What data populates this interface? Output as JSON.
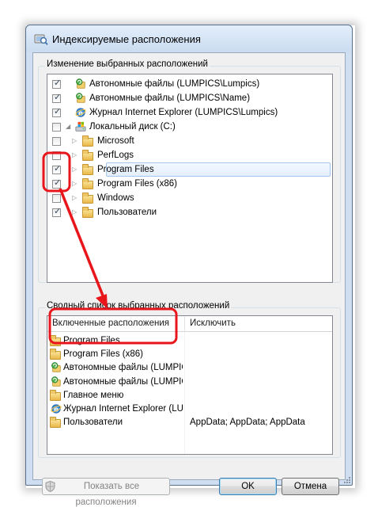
{
  "window": {
    "title": "Индексируемые расположения",
    "title_icon": "indexing-options-icon"
  },
  "change_group": {
    "label": "Изменение выбранных расположений",
    "items": [
      {
        "label": "Автономные файлы (LUMPICS\\Lumpics)",
        "checked": true,
        "icon": "offline-files-icon",
        "level": 0
      },
      {
        "label": "Автономные файлы (LUMPICS\\Name)",
        "checked": true,
        "icon": "offline-files-icon",
        "level": 0
      },
      {
        "label": "Журнал Internet Explorer (LUMPICS\\Lumpics)",
        "checked": true,
        "icon": "internet-explorer-icon",
        "level": 0
      },
      {
        "label": "Локальный диск (C:)",
        "checked": false,
        "icon": "local-disk-icon",
        "level": 0,
        "expanded": true
      },
      {
        "label": "Microsoft",
        "checked": false,
        "icon": "folder-icon",
        "level": 1
      },
      {
        "label": "PerfLogs",
        "checked": false,
        "icon": "folder-icon",
        "level": 1
      },
      {
        "label": "Program Files",
        "checked": true,
        "icon": "folder-icon",
        "level": 1,
        "selected": true
      },
      {
        "label": "Program Files (x86)",
        "checked": true,
        "icon": "folder-icon",
        "level": 1
      },
      {
        "label": "Windows",
        "checked": false,
        "icon": "folder-icon",
        "level": 1
      },
      {
        "label": "Пользователи",
        "checked": true,
        "icon": "folder-icon",
        "level": 1
      }
    ]
  },
  "summary_group": {
    "label": "Сводный список выбранных расположений",
    "columns": [
      "Включенные расположения",
      "Исключить"
    ],
    "rows": [
      {
        "included": "Program Files",
        "exclude": "",
        "icon": "folder-icon"
      },
      {
        "included": "Program Files (x86)",
        "exclude": "",
        "icon": "folder-icon"
      },
      {
        "included": "Автономные файлы (LUMPICS\\Lumpics)",
        "exclude": "",
        "icon": "offline-files-icon"
      },
      {
        "included": "Автономные файлы (LUMPICS\\Name)",
        "exclude": "",
        "icon": "offline-files-icon"
      },
      {
        "included": "Главное меню",
        "exclude": "",
        "icon": "folder-icon"
      },
      {
        "included": "Журнал Internet Explorer (LUMPICS\\Lumpics)",
        "exclude": "",
        "icon": "internet-explorer-icon"
      },
      {
        "included": "Пользователи",
        "exclude": "AppData; AppData; AppData",
        "icon": "folder-icon"
      }
    ]
  },
  "buttons": {
    "show_all": "Показать все расположения",
    "ok": "OK",
    "cancel": "Отмена"
  },
  "colors": {
    "annotation": "#e8161b",
    "selection": "#e4effc"
  }
}
